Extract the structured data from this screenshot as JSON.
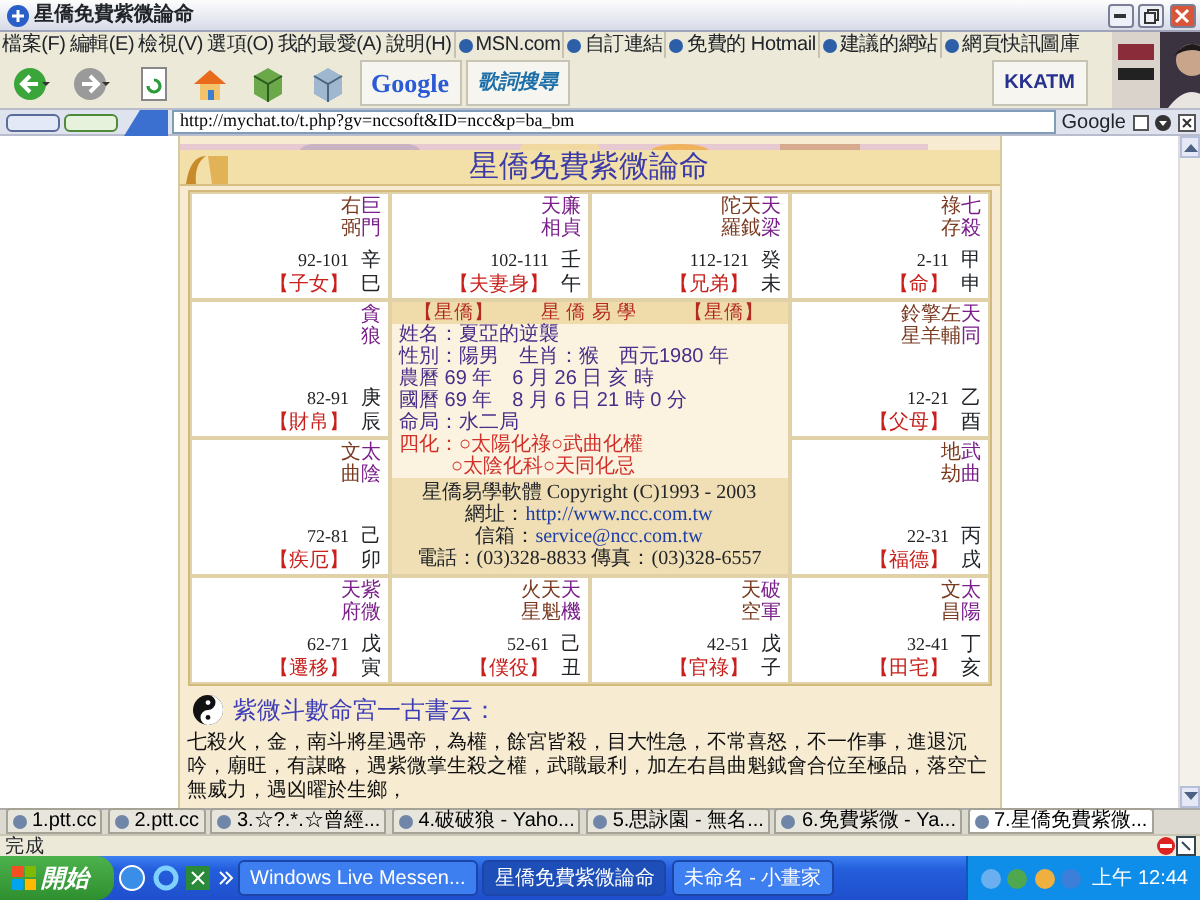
{
  "window": {
    "title": "星僑免費紫微論命"
  },
  "menus": [
    "檔案(F)",
    "編輯(E)",
    "檢視(V)",
    "選項(O)",
    "我的最愛(A)",
    "說明(H)"
  ],
  "links": [
    "MSN.com",
    "自訂連結",
    "免費的 Hotmail",
    "建議的網站",
    "網頁快訊圖庫"
  ],
  "toolbar": {
    "google": "Google",
    "lyrics": "歌詞搜尋",
    "kkatm": "KKATM"
  },
  "address": {
    "url": "http://mychat.to/t.php?gv=nccsoft&ID=ncc&p=ba_bm",
    "search_label": "Google"
  },
  "page": {
    "title": "星僑免費紫微論命",
    "palaces": [
      {
        "stars": [
          {
            "name": "右弼",
            "kind": "minor"
          },
          {
            "name": "巨門",
            "kind": "major"
          }
        ],
        "age": "92-101",
        "stem": "辛",
        "palace": "【子女】",
        "branch": "巳"
      },
      {
        "stars": [
          {
            "name": "天相",
            "kind": "major"
          },
          {
            "name": "廉貞",
            "kind": "major"
          }
        ],
        "age": "102-111",
        "stem": "壬",
        "palace": "【夫妻身】",
        "branch": "午"
      },
      {
        "stars": [
          {
            "name": "陀羅",
            "kind": "minor"
          },
          {
            "name": "天鉞",
            "kind": "minor"
          },
          {
            "name": "天梁",
            "kind": "major"
          }
        ],
        "age": "112-121",
        "stem": "癸",
        "palace": "【兄弟】",
        "branch": "未"
      },
      {
        "stars": [
          {
            "name": "祿存",
            "kind": "minor"
          },
          {
            "name": "七殺",
            "kind": "major"
          }
        ],
        "age": "2-11",
        "stem": "甲",
        "palace": "【命】",
        "branch": "申"
      },
      {
        "stars": [
          {
            "name": "貪狼",
            "kind": "major"
          }
        ],
        "age": "82-91",
        "stem": "庚",
        "palace": "【財帛】",
        "branch": "辰"
      },
      {
        "stars": [
          {
            "name": "鈴星",
            "kind": "minor"
          },
          {
            "name": "擎羊",
            "kind": "minor"
          },
          {
            "name": "左輔",
            "kind": "minor"
          },
          {
            "name": "天同",
            "kind": "major"
          }
        ],
        "age": "12-21",
        "stem": "乙",
        "palace": "【父母】",
        "branch": "酉"
      },
      {
        "stars": [
          {
            "name": "文曲",
            "kind": "minor"
          },
          {
            "name": "太陰",
            "kind": "major"
          }
        ],
        "age": "72-81",
        "stem": "己",
        "palace": "【疾厄】",
        "branch": "卯"
      },
      {
        "stars": [
          {
            "name": "地劫",
            "kind": "minor"
          },
          {
            "name": "武曲",
            "kind": "major"
          }
        ],
        "age": "22-31",
        "stem": "丙",
        "palace": "【福德】",
        "branch": "戌"
      },
      {
        "stars": [
          {
            "name": "天府",
            "kind": "major"
          },
          {
            "name": "紫微",
            "kind": "major"
          }
        ],
        "age": "62-71",
        "stem": "戊",
        "palace": "【遷移】",
        "branch": "寅"
      },
      {
        "stars": [
          {
            "name": "火星",
            "kind": "minor"
          },
          {
            "name": "天魁",
            "kind": "minor"
          },
          {
            "name": "天機",
            "kind": "major"
          }
        ],
        "age": "52-61",
        "stem": "己",
        "palace": "【僕役】",
        "branch": "丑"
      },
      {
        "stars": [
          {
            "name": "天空",
            "kind": "minor"
          },
          {
            "name": "破軍",
            "kind": "major"
          }
        ],
        "age": "42-51",
        "stem": "戊",
        "palace": "【官祿】",
        "branch": "子"
      },
      {
        "stars": [
          {
            "name": "文昌",
            "kind": "minor"
          },
          {
            "name": "太陽",
            "kind": "major"
          }
        ],
        "age": "32-41",
        "stem": "丁",
        "palace": "【田宅】",
        "branch": "亥"
      }
    ],
    "center": {
      "header": [
        "【星僑】",
        "星 僑 易 學",
        "【星僑】"
      ],
      "lines": [
        {
          "text": "姓名：夏亞的逆襲",
          "kind": "info"
        },
        {
          "text": "性別：陽男　生肖：猴　西元1980 年",
          "kind": "info"
        },
        {
          "text": "農曆 69 年　6 月 26 日 亥 時",
          "kind": "info"
        },
        {
          "text": "國曆 69 年　8 月 6 日 21 時 0 分",
          "kind": "info"
        },
        {
          "text": "命局：水二局",
          "kind": "info"
        },
        {
          "text": "四化：○太陽化祿○武曲化權",
          "kind": "sihua"
        },
        {
          "text": "○太陰化科○天同化忌",
          "kind": "sihua"
        }
      ],
      "copyright": "星僑易學軟體 Copyright (C)1993 - 2003",
      "contacts": [
        {
          "label": "網址：",
          "link": "http://www.ncc.com.tw"
        },
        {
          "label": "信箱：",
          "link": "service@ncc.com.tw"
        }
      ],
      "phone": "電話：(03)328-8833 傳真：(03)328-6557"
    },
    "heading": "紫微斗數命宮一古書云：",
    "paragraph": "七殺火，金，南斗將星遇帝，為權，餘宮皆殺，目大性急，不常喜怒，不一作事，進退沉吟，廟旺，有謀略，遇紫微掌生殺之權，武職最利，加左右昌曲魁鉞會合位至極品，落空亡無威力，遇凶曜於生鄉，"
  },
  "tabs": [
    {
      "label": "1.ptt.cc",
      "selected": false
    },
    {
      "label": "2.ptt.cc",
      "selected": false
    },
    {
      "label": "3.☆?.*.☆曾經...",
      "selected": false
    },
    {
      "label": "4.破破狼 - Yaho...",
      "selected": false
    },
    {
      "label": "5.思詠園 - 無名...",
      "selected": false
    },
    {
      "label": "6.免費紫微 - Ya...",
      "selected": false
    },
    {
      "label": "7.星僑免費紫微...",
      "selected": true
    }
  ],
  "status_bar": {
    "text": "完成"
  },
  "taskbar": {
    "start": "開始",
    "tasks": [
      {
        "label": "Windows Live Messen...",
        "selected": false
      },
      {
        "label": "星僑免費紫微論命",
        "selected": true
      },
      {
        "label": "未命名 - 小畫家",
        "selected": false
      }
    ],
    "clock": "上午 12:44"
  }
}
